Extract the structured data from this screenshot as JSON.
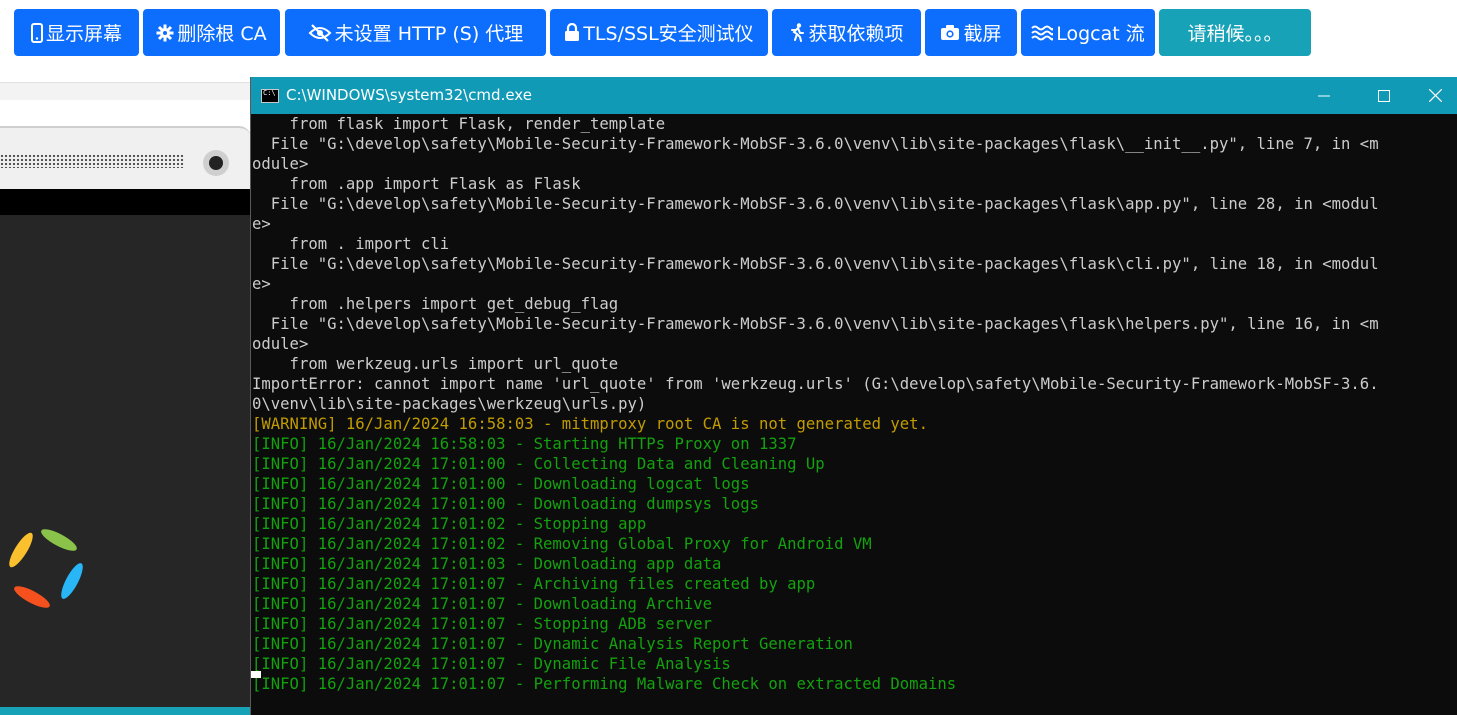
{
  "toolbar": {
    "buttons": [
      {
        "label": "显示屏幕",
        "icon": "mobile-icon"
      },
      {
        "label": "删除根 CA",
        "icon": "gear-icon"
      },
      {
        "label": "未设置 HTTP (S) 代理",
        "icon": "eye-slash-icon"
      },
      {
        "label": "TLS/SSL安全测试仪",
        "icon": "lock-icon"
      },
      {
        "label": "获取依赖项",
        "icon": "running-icon"
      },
      {
        "label": "截屏",
        "icon": "camera-icon"
      },
      {
        "label": "Logcat 流",
        "icon": "stream-icon"
      },
      {
        "label": "请稍候。。。",
        "icon": ""
      }
    ],
    "colors": {
      "primary": "#0d6efd",
      "info": "#17a2b8"
    }
  },
  "cmd": {
    "title": "C:\\WINDOWS\\system32\\cmd.exe",
    "titlebar_color": "#119ab6",
    "lines": [
      {
        "text": "    from flask import Flask, render_template",
        "type": "normal"
      },
      {
        "text": "  File \"G:\\develop\\safety\\Mobile-Security-Framework-MobSF-3.6.0\\venv\\lib\\site-packages\\flask\\__init__.py\", line 7, in <m",
        "type": "normal"
      },
      {
        "text": "odule>",
        "type": "normal"
      },
      {
        "text": "    from .app import Flask as Flask",
        "type": "normal"
      },
      {
        "text": "  File \"G:\\develop\\safety\\Mobile-Security-Framework-MobSF-3.6.0\\venv\\lib\\site-packages\\flask\\app.py\", line 28, in <modul",
        "type": "normal"
      },
      {
        "text": "e>",
        "type": "normal"
      },
      {
        "text": "    from . import cli",
        "type": "normal"
      },
      {
        "text": "  File \"G:\\develop\\safety\\Mobile-Security-Framework-MobSF-3.6.0\\venv\\lib\\site-packages\\flask\\cli.py\", line 18, in <modul",
        "type": "normal"
      },
      {
        "text": "e>",
        "type": "normal"
      },
      {
        "text": "    from .helpers import get_debug_flag",
        "type": "normal"
      },
      {
        "text": "  File \"G:\\develop\\safety\\Mobile-Security-Framework-MobSF-3.6.0\\venv\\lib\\site-packages\\flask\\helpers.py\", line 16, in <m",
        "type": "normal"
      },
      {
        "text": "odule>",
        "type": "normal"
      },
      {
        "text": "    from werkzeug.urls import url_quote",
        "type": "normal"
      },
      {
        "text": "ImportError: cannot import name 'url_quote' from 'werkzeug.urls' (G:\\develop\\safety\\Mobile-Security-Framework-MobSF-3.6.",
        "type": "normal"
      },
      {
        "text": "0\\venv\\lib\\site-packages\\werkzeug\\urls.py)",
        "type": "normal"
      },
      {
        "text": "[WARNING] 16/Jan/2024 16:58:03 - mitmproxy root CA is not generated yet.",
        "type": "warn"
      },
      {
        "text": "[INFO] 16/Jan/2024 16:58:03 - Starting HTTPs Proxy on 1337",
        "type": "info"
      },
      {
        "text": "[INFO] 16/Jan/2024 17:01:00 - Collecting Data and Cleaning Up",
        "type": "info"
      },
      {
        "text": "[INFO] 16/Jan/2024 17:01:00 - Downloading logcat logs",
        "type": "info"
      },
      {
        "text": "[INFO] 16/Jan/2024 17:01:00 - Downloading dumpsys logs",
        "type": "info"
      },
      {
        "text": "[INFO] 16/Jan/2024 17:01:02 - Stopping app",
        "type": "info"
      },
      {
        "text": "[INFO] 16/Jan/2024 17:01:02 - Removing Global Proxy for Android VM",
        "type": "info"
      },
      {
        "text": "[INFO] 16/Jan/2024 17:01:03 - Downloading app data",
        "type": "info"
      },
      {
        "text": "[INFO] 16/Jan/2024 17:01:07 - Archiving files created by app",
        "type": "info"
      },
      {
        "text": "[INFO] 16/Jan/2024 17:01:07 - Downloading Archive",
        "type": "info"
      },
      {
        "text": "[INFO] 16/Jan/2024 17:01:07 - Stopping ADB server",
        "type": "info"
      },
      {
        "text": "[INFO] 16/Jan/2024 17:01:07 - Dynamic Analysis Report Generation",
        "type": "info"
      },
      {
        "text": "[INFO] 16/Jan/2024 17:01:07 - Dynamic File Analysis",
        "type": "info"
      },
      {
        "text": "[INFO] 16/Jan/2024 17:01:07 - Performing Malware Check on extracted Domains",
        "type": "info"
      }
    ],
    "colors": {
      "normal": "#cccccc",
      "warn": "#c19c00",
      "info": "#13a10e"
    }
  }
}
